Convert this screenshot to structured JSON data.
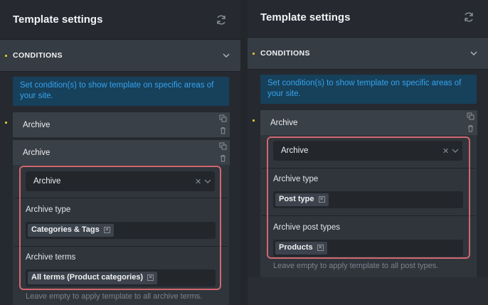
{
  "left": {
    "title": "Template settings",
    "conditions_label": "CONDITIONS",
    "info_text": "Set condition(s) to show template on specific areas of your site.",
    "row1_label": "Archive",
    "row2_label": "Archive",
    "select_value": "Archive",
    "field1_label": "Archive type",
    "field1_tag": "Categories & Tags",
    "field2_label": "Archive terms",
    "field2_tag": "All terms (Product categories)",
    "hint": "Leave empty to apply template to all archive terms."
  },
  "right": {
    "title": "Template settings",
    "conditions_label": "CONDITIONS",
    "info_text": "Set condition(s) to show template on specific areas of your site.",
    "row1_label": "Archive",
    "select_value": "Archive",
    "field1_label": "Archive type",
    "field1_tag": "Post type",
    "field2_label": "Archive post types",
    "field2_tag": "Products",
    "hint": "Leave empty to apply template to all post types."
  },
  "icons": {
    "refresh": "refresh-icon",
    "chevron": "chevron-down-icon",
    "duplicate": "duplicate-icon",
    "trash": "trash-icon",
    "clear": "clear-icon",
    "tag_remove": "remove-tag-icon"
  },
  "colors": {
    "accent_blue": "#36a3ee",
    "highlight": "#d2676f",
    "dot_yellow": "#e3c72a"
  }
}
